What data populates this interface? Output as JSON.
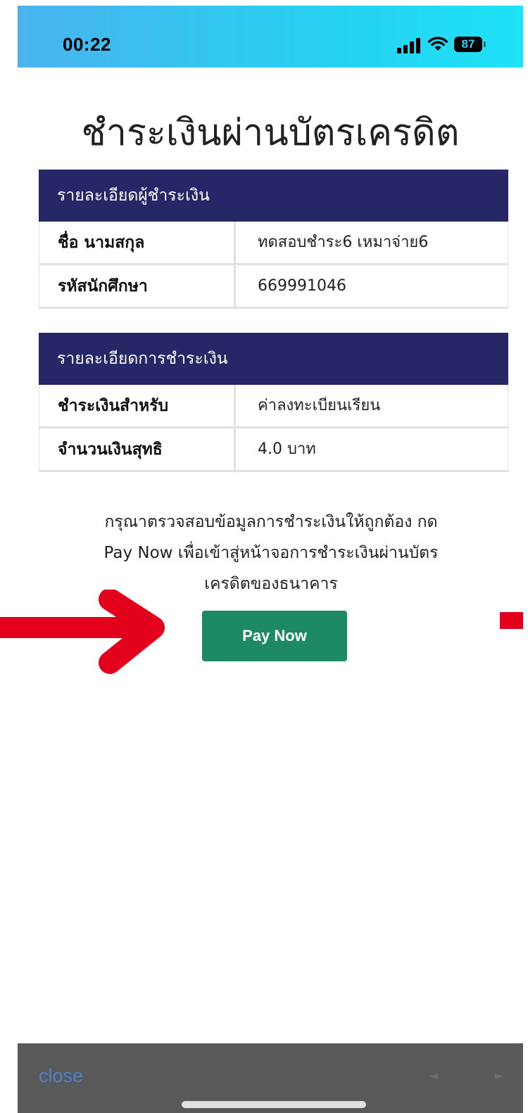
{
  "status_bar": {
    "time": "00:22",
    "battery": "87",
    "background_colors": [
      "#4ab3ee",
      "#1ee2f6"
    ]
  },
  "page": {
    "title": "ชำระเงินผ่านบัตรเครดิต"
  },
  "payer_details": {
    "header": "รายละเอียดผู้ชำระเงิน",
    "rows": [
      {
        "label": "ชื่อ นามสกุล",
        "value": "ทดสอบชำระ6 เหมาจ่าย6"
      },
      {
        "label": "รหัสนักศึกษา",
        "value": "669991046"
      }
    ]
  },
  "payment_details": {
    "header": "รายละเอียดการชำระเงิน",
    "rows": [
      {
        "label": "ชำระเงินสำหรับ",
        "value": "ค่าลงทะเบียนเรียน"
      },
      {
        "label": "จำนวนเงินสุทธิ",
        "value": "4.0 บาท"
      }
    ]
  },
  "instructions": {
    "lines": [
      "กรุณาตรวจสอบข้อมูลการชำระเงินให้ถูกต้อง กด",
      "Pay Now เพื่อเข้าสู่หน้าจอการชำระเงินผ่านบัตร",
      "เครดิตของธนาคาร"
    ]
  },
  "actions": {
    "pay_now_label": "Pay Now",
    "pay_now_color": "#1e8a63"
  },
  "bottom_toolbar": {
    "close_label": "close",
    "back_icon": "triangle-left-icon",
    "forward_icon": "triangle-right-icon"
  },
  "colors": {
    "header_bg": "#272666",
    "annotation_arrow": "#e2001d"
  }
}
